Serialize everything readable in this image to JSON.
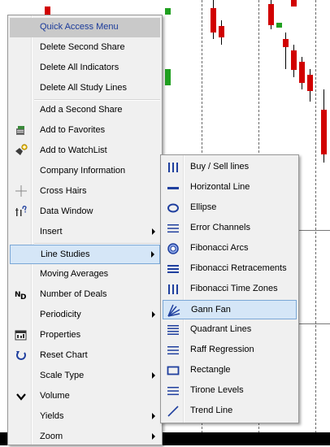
{
  "menu": {
    "header": "Quick Access Menu",
    "items": [
      {
        "label": "Delete Second Share",
        "icon": "",
        "submenu": false
      },
      {
        "label": "Delete All Indicators",
        "icon": "",
        "submenu": false
      },
      {
        "label": "Delete All Study Lines",
        "icon": "",
        "submenu": false
      },
      {
        "label": "Add a Second Share",
        "icon": "",
        "submenu": false
      },
      {
        "label": "Add to Favorites",
        "icon": "favorites-icon",
        "submenu": false
      },
      {
        "label": "Add to WatchList",
        "icon": "watchlist-icon",
        "submenu": false
      },
      {
        "label": "Company Information",
        "icon": "",
        "submenu": false
      },
      {
        "label": "Cross Hairs",
        "icon": "crosshair-icon",
        "submenu": false
      },
      {
        "label": "Data Window",
        "icon": "data-window-icon",
        "submenu": false
      },
      {
        "label": "Insert",
        "icon": "",
        "submenu": true
      },
      {
        "label": "Line Studies",
        "icon": "",
        "submenu": true,
        "highlighted": true
      },
      {
        "label": "Moving Averages",
        "icon": "",
        "submenu": false
      },
      {
        "label": "Number of Deals",
        "icon": "number-of-deals-icon",
        "submenu": false
      },
      {
        "label": "Periodicity",
        "icon": "",
        "submenu": true
      },
      {
        "label": "Properties",
        "icon": "properties-icon",
        "submenu": false
      },
      {
        "label": "Reset Chart",
        "icon": "reset-icon",
        "submenu": false
      },
      {
        "label": "Scale Type",
        "icon": "",
        "submenu": true
      },
      {
        "label": "Volume",
        "icon": "volume-icon",
        "submenu": false
      },
      {
        "label": "Yields",
        "icon": "",
        "submenu": true
      },
      {
        "label": "Zoom",
        "icon": "",
        "submenu": true
      }
    ]
  },
  "submenu": {
    "items": [
      {
        "label": "Buy / Sell lines",
        "icon": "buy-sell-lines-icon"
      },
      {
        "label": "Horizontal Line",
        "icon": "horizontal-line-icon"
      },
      {
        "label": "Ellipse",
        "icon": "ellipse-icon"
      },
      {
        "label": "Error Channels",
        "icon": "error-channels-icon"
      },
      {
        "label": "Fibonacci Arcs",
        "icon": "fibonacci-arcs-icon"
      },
      {
        "label": "Fibonacci Retracements",
        "icon": "fibonacci-retracements-icon"
      },
      {
        "label": "Fibonacci Time Zones",
        "icon": "fibonacci-time-zones-icon"
      },
      {
        "label": "Gann Fan",
        "icon": "gann-fan-icon",
        "highlighted": true
      },
      {
        "label": "Quadrant Lines",
        "icon": "quadrant-lines-icon"
      },
      {
        "label": "Raff Regression",
        "icon": "raff-regression-icon"
      },
      {
        "label": "Rectangle",
        "icon": "rectangle-icon"
      },
      {
        "label": "Tirone Levels",
        "icon": "tirone-levels-icon"
      },
      {
        "label": "Trend Line",
        "icon": "trend-line-icon"
      }
    ]
  },
  "colors": {
    "header_bg": "#c9c9c9",
    "highlight_bg": "#d5e6f7",
    "highlight_border": "#7aa7d6",
    "icon_blue": "#1f3f9e",
    "candle_red": "#d10000",
    "candle_green": "#20a020"
  }
}
